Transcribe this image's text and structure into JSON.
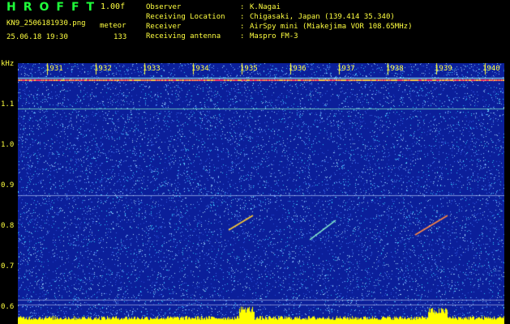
{
  "header": {
    "logo": "HROFFT",
    "version": "1.00f",
    "filename": "KN9_2506181930.png",
    "mode": "meteor",
    "datetime": "25.06.18 19:30",
    "count": "133",
    "info": [
      {
        "label": "Observer",
        "value": "K.Nagai"
      },
      {
        "label": "Receiving Location",
        "value": "Chigasaki, Japan (139.414 35.340)"
      },
      {
        "label": "Receiver",
        "value": "AirSpy mini (Miakejima VOR 108.65MHz)"
      },
      {
        "label": "Receiving antenna",
        "value": "Maspro FM-3"
      }
    ]
  },
  "axis": {
    "y_unit": "kHz",
    "y_ticks": [
      "1.1",
      "1.0",
      "0.9",
      "0.8",
      "0.7",
      "0.6"
    ],
    "x_ticks": [
      "1931",
      "1932",
      "1933",
      "1934",
      "1935",
      "1936",
      "1937",
      "1938",
      "1939",
      "1940"
    ]
  },
  "colors": {
    "background": "#0b1f9a",
    "noise": "#6ab4ff",
    "label": "#ffff40",
    "logo": "#1fff3a",
    "carrier": "#ff3366",
    "histogram": "#ffff00"
  }
}
